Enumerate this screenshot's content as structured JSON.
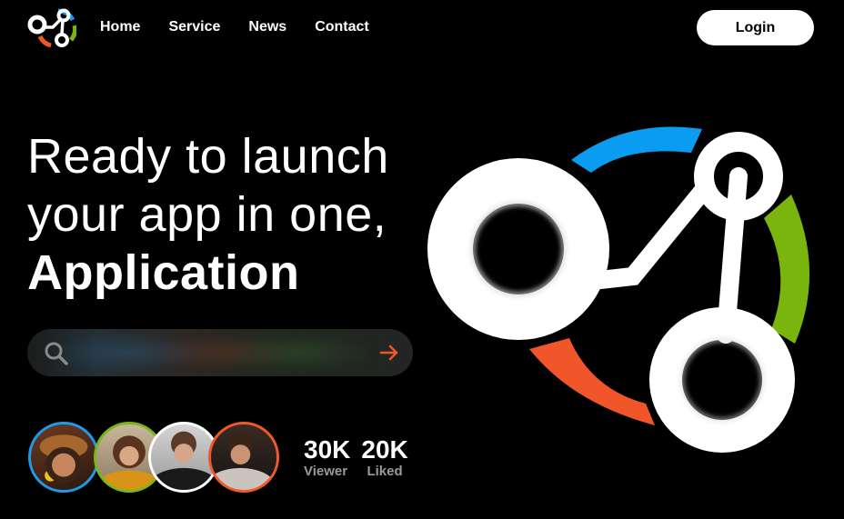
{
  "nav": {
    "links": [
      "Home",
      "Service",
      "News",
      "Contact"
    ],
    "login_label": "Login"
  },
  "hero": {
    "line1": "Ready to launch",
    "line2": "your app in one,",
    "line3": "Application"
  },
  "search": {
    "placeholder": "",
    "search_icon": "search-icon",
    "submit_icon": "arrow-right-icon"
  },
  "stats": [
    {
      "value": "30K",
      "label": "Viewer"
    },
    {
      "value": "20K",
      "label": "Liked"
    }
  ],
  "avatars": [
    {
      "ring_color": "#1e9be8",
      "name": "avatar-woman-hat"
    },
    {
      "ring_color": "#7bb51c",
      "name": "avatar-woman-yellow"
    },
    {
      "ring_color": "#ffffff",
      "name": "avatar-man-hoodie"
    },
    {
      "ring_color": "#ef5a28",
      "name": "avatar-man-beard"
    }
  ],
  "colors": {
    "background": "#000000",
    "blue": "#0a9cf0",
    "green": "#7ab50d",
    "orange": "#f0562a",
    "accent_arrow": "#f0562a"
  }
}
